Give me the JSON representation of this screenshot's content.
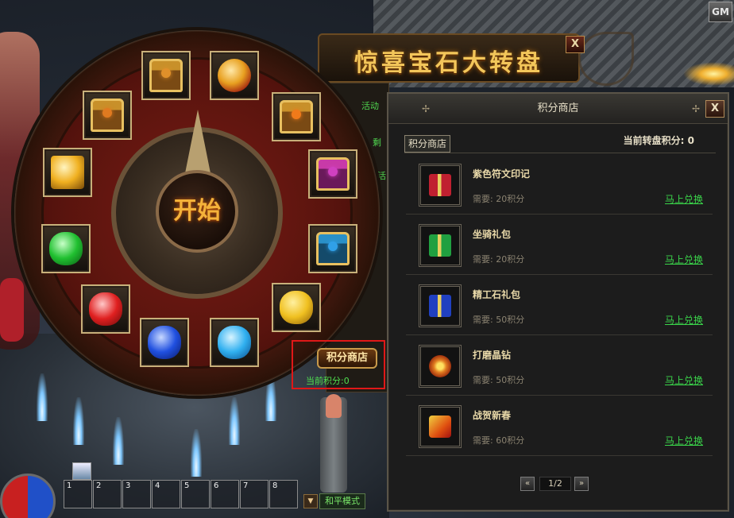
{
  "wheel": {
    "title": "惊喜宝石大转盘",
    "close_label": "X",
    "start_label": "开始",
    "info_lines": [
      "活动",
      "剩",
      "活"
    ],
    "points_shop_label": "积分商店",
    "current_points": "当前积分:0",
    "slots": [
      {
        "name": "treasure-chest-gold",
        "kind": "chest",
        "gem": "#e0902a"
      },
      {
        "name": "fire-orb",
        "kind": "orb"
      },
      {
        "name": "treasure-chest-orange",
        "kind": "chest",
        "gem": "#f07a1a"
      },
      {
        "name": "treasure-chest-purple",
        "kind": "chest",
        "gem": "#d040c0"
      },
      {
        "name": "treasure-chest-blue",
        "kind": "chest",
        "gem": "#30a0e8"
      },
      {
        "name": "yellow-gem",
        "kind": "gem",
        "color": "#f0c020"
      },
      {
        "name": "blue-gem-light",
        "kind": "gem",
        "color": "#30b0f0"
      },
      {
        "name": "blue-gem-dark",
        "kind": "gem",
        "color": "#2050e0"
      },
      {
        "name": "red-gem",
        "kind": "gem",
        "color": "#e02020"
      },
      {
        "name": "green-gem",
        "kind": "gem",
        "color": "#20c030"
      },
      {
        "name": "topaz-gem",
        "kind": "gem",
        "color": "#f0b020"
      },
      {
        "name": "treasure-chest-locked",
        "kind": "chest",
        "gem": "#e07a20"
      }
    ]
  },
  "shop": {
    "title": "积分商店",
    "close_label": "X",
    "tab_label": "积分商店",
    "turntable_points": "当前转盘积分: 0",
    "items": [
      {
        "name": "紫色符文印记",
        "cost": "需要: 20积分",
        "action": "马上兑换",
        "icon": "gift-red-icon",
        "color": "#c02030"
      },
      {
        "name": "坐骑礼包",
        "cost": "需要: 20积分",
        "action": "马上兑换",
        "icon": "gift-green-icon",
        "color": "#20a040"
      },
      {
        "name": "精工石礼包",
        "cost": "需要: 50积分",
        "action": "马上兑换",
        "icon": "gift-blue-icon",
        "color": "#2040c0"
      },
      {
        "name": "打磨晶钻",
        "cost": "需要: 50积分",
        "action": "马上兑换",
        "icon": "crystal-icon",
        "color": "#e07a20"
      },
      {
        "name": "战贺新春",
        "cost": "需要: 60积分",
        "action": "马上兑换",
        "icon": "new-spring-icon",
        "color": "#e0a020"
      }
    ],
    "page_indicator": "1/2",
    "prev_label": "«",
    "next_label": "»"
  },
  "hud": {
    "gm_label": "GM",
    "hotbar": [
      "1",
      "2",
      "3",
      "4",
      "5",
      "6",
      "7",
      "8"
    ],
    "mode_label": "和平模式",
    "mode_arrow": "▼"
  }
}
